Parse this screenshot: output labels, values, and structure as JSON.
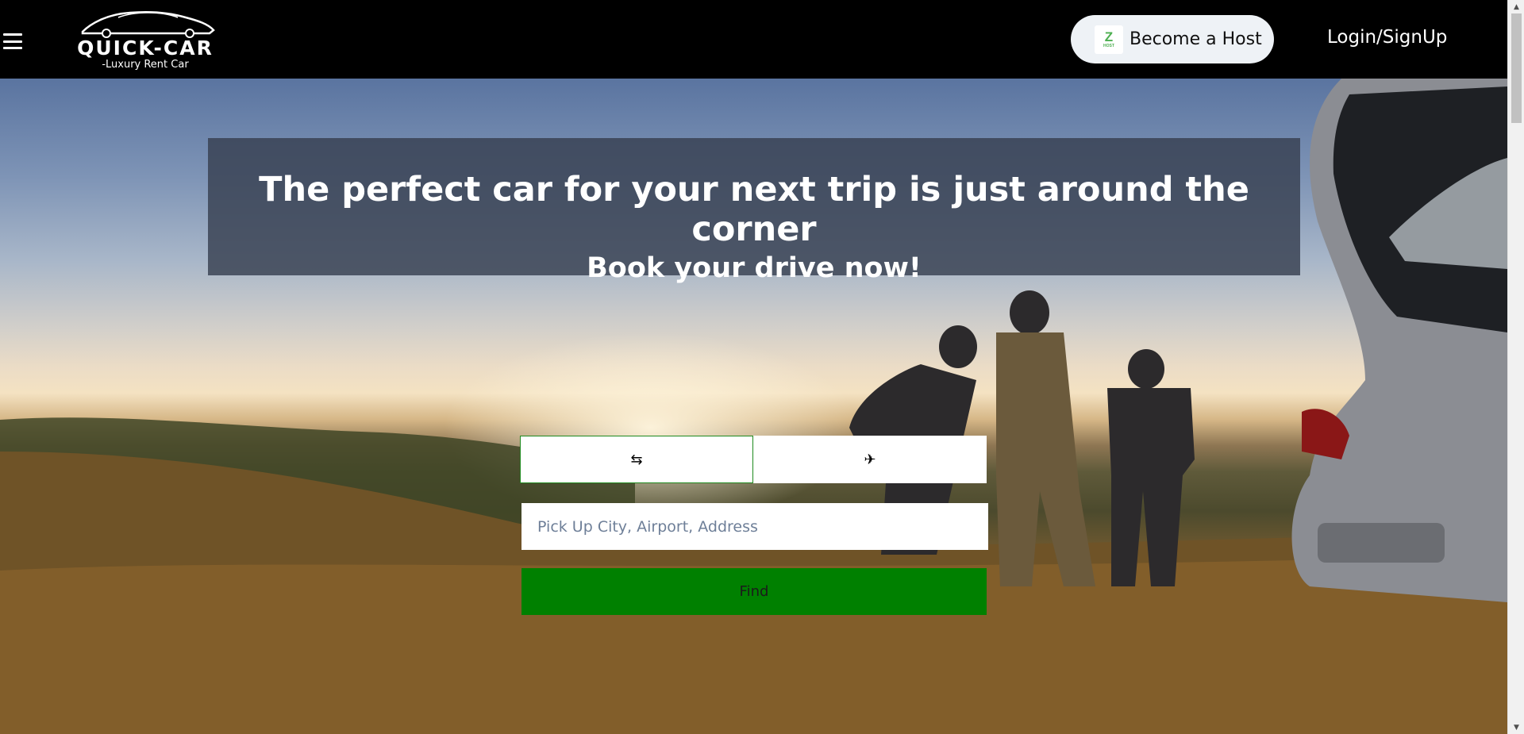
{
  "header": {
    "menu_icon": "hamburger-icon",
    "logo": {
      "title": "QUICK-CAR",
      "subtitle": "-Luxury Rent Car"
    },
    "host_button": {
      "badge_letter": "Z",
      "badge_text": "HOST",
      "label": "Become a Host"
    },
    "login_label": "Login/SignUp"
  },
  "hero": {
    "headline": "The perfect car for your next trip is just around the corner",
    "subheadline": "Book your drive now!"
  },
  "search": {
    "tabs": [
      {
        "icon": "swap-arrows-icon",
        "glyph": "⇆",
        "active": true
      },
      {
        "icon": "airplane-icon",
        "glyph": "✈",
        "active": false
      }
    ],
    "placeholder": "Pick Up City, Airport, Address",
    "find_label": "Find"
  },
  "colors": {
    "header_bg": "#000000",
    "find_button": "#008000",
    "headline_panel": "#373f50",
    "host_button_bg": "#eef2f6"
  }
}
